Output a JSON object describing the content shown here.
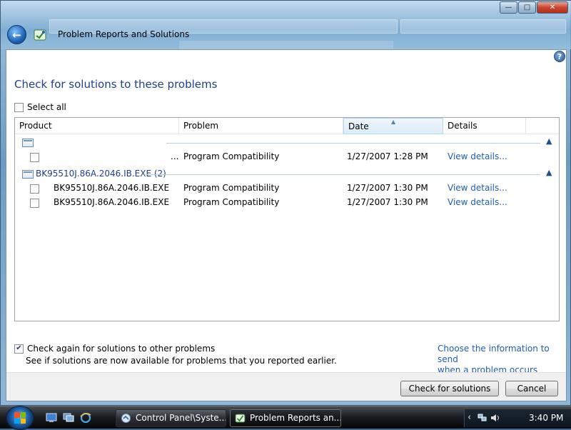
{
  "window": {
    "title": "Problem Reports and Solutions",
    "caption": {
      "minimize": "—",
      "maximize": "□",
      "close": "✕"
    }
  },
  "help_icon": "?",
  "heading": "Check for solutions to these problems",
  "select_all": {
    "label": "Select all",
    "checked": false
  },
  "columns": [
    "Product",
    "Problem",
    "Date",
    "Details"
  ],
  "groups": [
    {
      "label": "",
      "collapse_icon": "chevron-up-icon",
      "rows": [
        {
          "product": "...",
          "problem": "Program Compatibility",
          "date": "1/27/2007 1:28 PM",
          "details": "View details..."
        }
      ]
    },
    {
      "label": "BK95510J.86A.2046.IB.EXE (2)",
      "collapse_icon": "chevron-up-icon",
      "rows": [
        {
          "product": "BK95510J.86A.2046.IB.EXE",
          "problem": "Program Compatibility",
          "date": "1/27/2007 1:30 PM",
          "details": "View details..."
        },
        {
          "product": "BK95510J.86A.2046.IB.EXE",
          "problem": "Program Compatibility",
          "date": "1/27/2007 1:30 PM",
          "details": "View details..."
        }
      ]
    }
  ],
  "check_again": {
    "label": "Check again for solutions to other problems",
    "checked": true,
    "description": "See if solutions are now available for problems that you reported earlier."
  },
  "send_info_link": {
    "line1": "Choose the information to send",
    "line2": "when a problem occurs"
  },
  "buttons": {
    "check": "Check for solutions",
    "cancel": "Cancel"
  },
  "taskbar": {
    "tasks": [
      {
        "label": "Control Panel\\Syste...",
        "active": false
      },
      {
        "label": "Problem Reports an...",
        "active": true
      }
    ],
    "clock": "3:40 PM"
  },
  "colors": {
    "heading": "#1e3f8f",
    "link": "#1f5db4"
  }
}
